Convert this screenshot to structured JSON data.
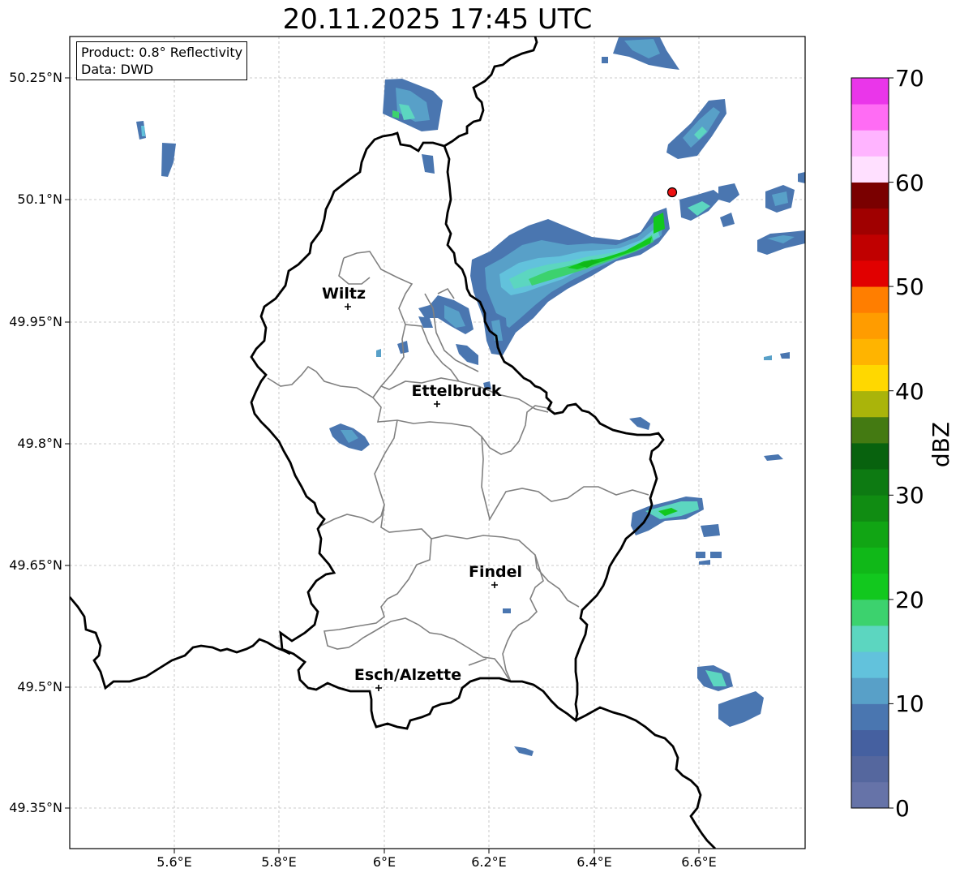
{
  "title": "20.11.2025 17:45 UTC",
  "info": {
    "product": "Product: 0.8° Reflectivity",
    "data_source": "Data: DWD"
  },
  "axes": {
    "lat_ticks": [
      "50.25°N",
      "50.1°N",
      "49.95°N",
      "49.8°N",
      "49.65°N",
      "49.5°N",
      "49.35°N"
    ],
    "lon_ticks": [
      "5.6°E",
      "5.8°E",
      "6°E",
      "6.2°E",
      "6.4°E",
      "6.6°E"
    ],
    "grid": true
  },
  "cities": [
    {
      "name": "Wiltz",
      "lon": 5.93,
      "lat": 49.967
    },
    {
      "name": "Ettelbruck",
      "lon": 6.1,
      "lat": 49.847
    },
    {
      "name": "Findel",
      "lon": 6.21,
      "lat": 49.627
    },
    {
      "name": "Esch/Alzette",
      "lon": 5.99,
      "lat": 49.499
    }
  ],
  "radar_site_marker": {
    "lon": 6.547,
    "lat": 50.111,
    "color": "#ee1111"
  },
  "colorbar": {
    "label": "dBZ",
    "ticks": [
      "0",
      "10",
      "20",
      "30",
      "40",
      "50",
      "60",
      "70"
    ],
    "range": [
      0,
      70
    ],
    "colors": [
      "#6673a8",
      "#55679e",
      "#4560a0",
      "#4a76b0",
      "#58a0c8",
      "#62c2dc",
      "#5cd6c0",
      "#3cd26e",
      "#12c81e",
      "#10b818",
      "#11a514",
      "#108c12",
      "#0d7a12",
      "#08620e",
      "#447a12",
      "#aab40a",
      "#ffd800",
      "#ffb400",
      "#ff9c00",
      "#ff7e00",
      "#e10000",
      "#c00000",
      "#a00000",
      "#7a0000",
      "#ffe0ff",
      "#ffb4ff",
      "#ff6cf4",
      "#ea36ea"
    ]
  }
}
